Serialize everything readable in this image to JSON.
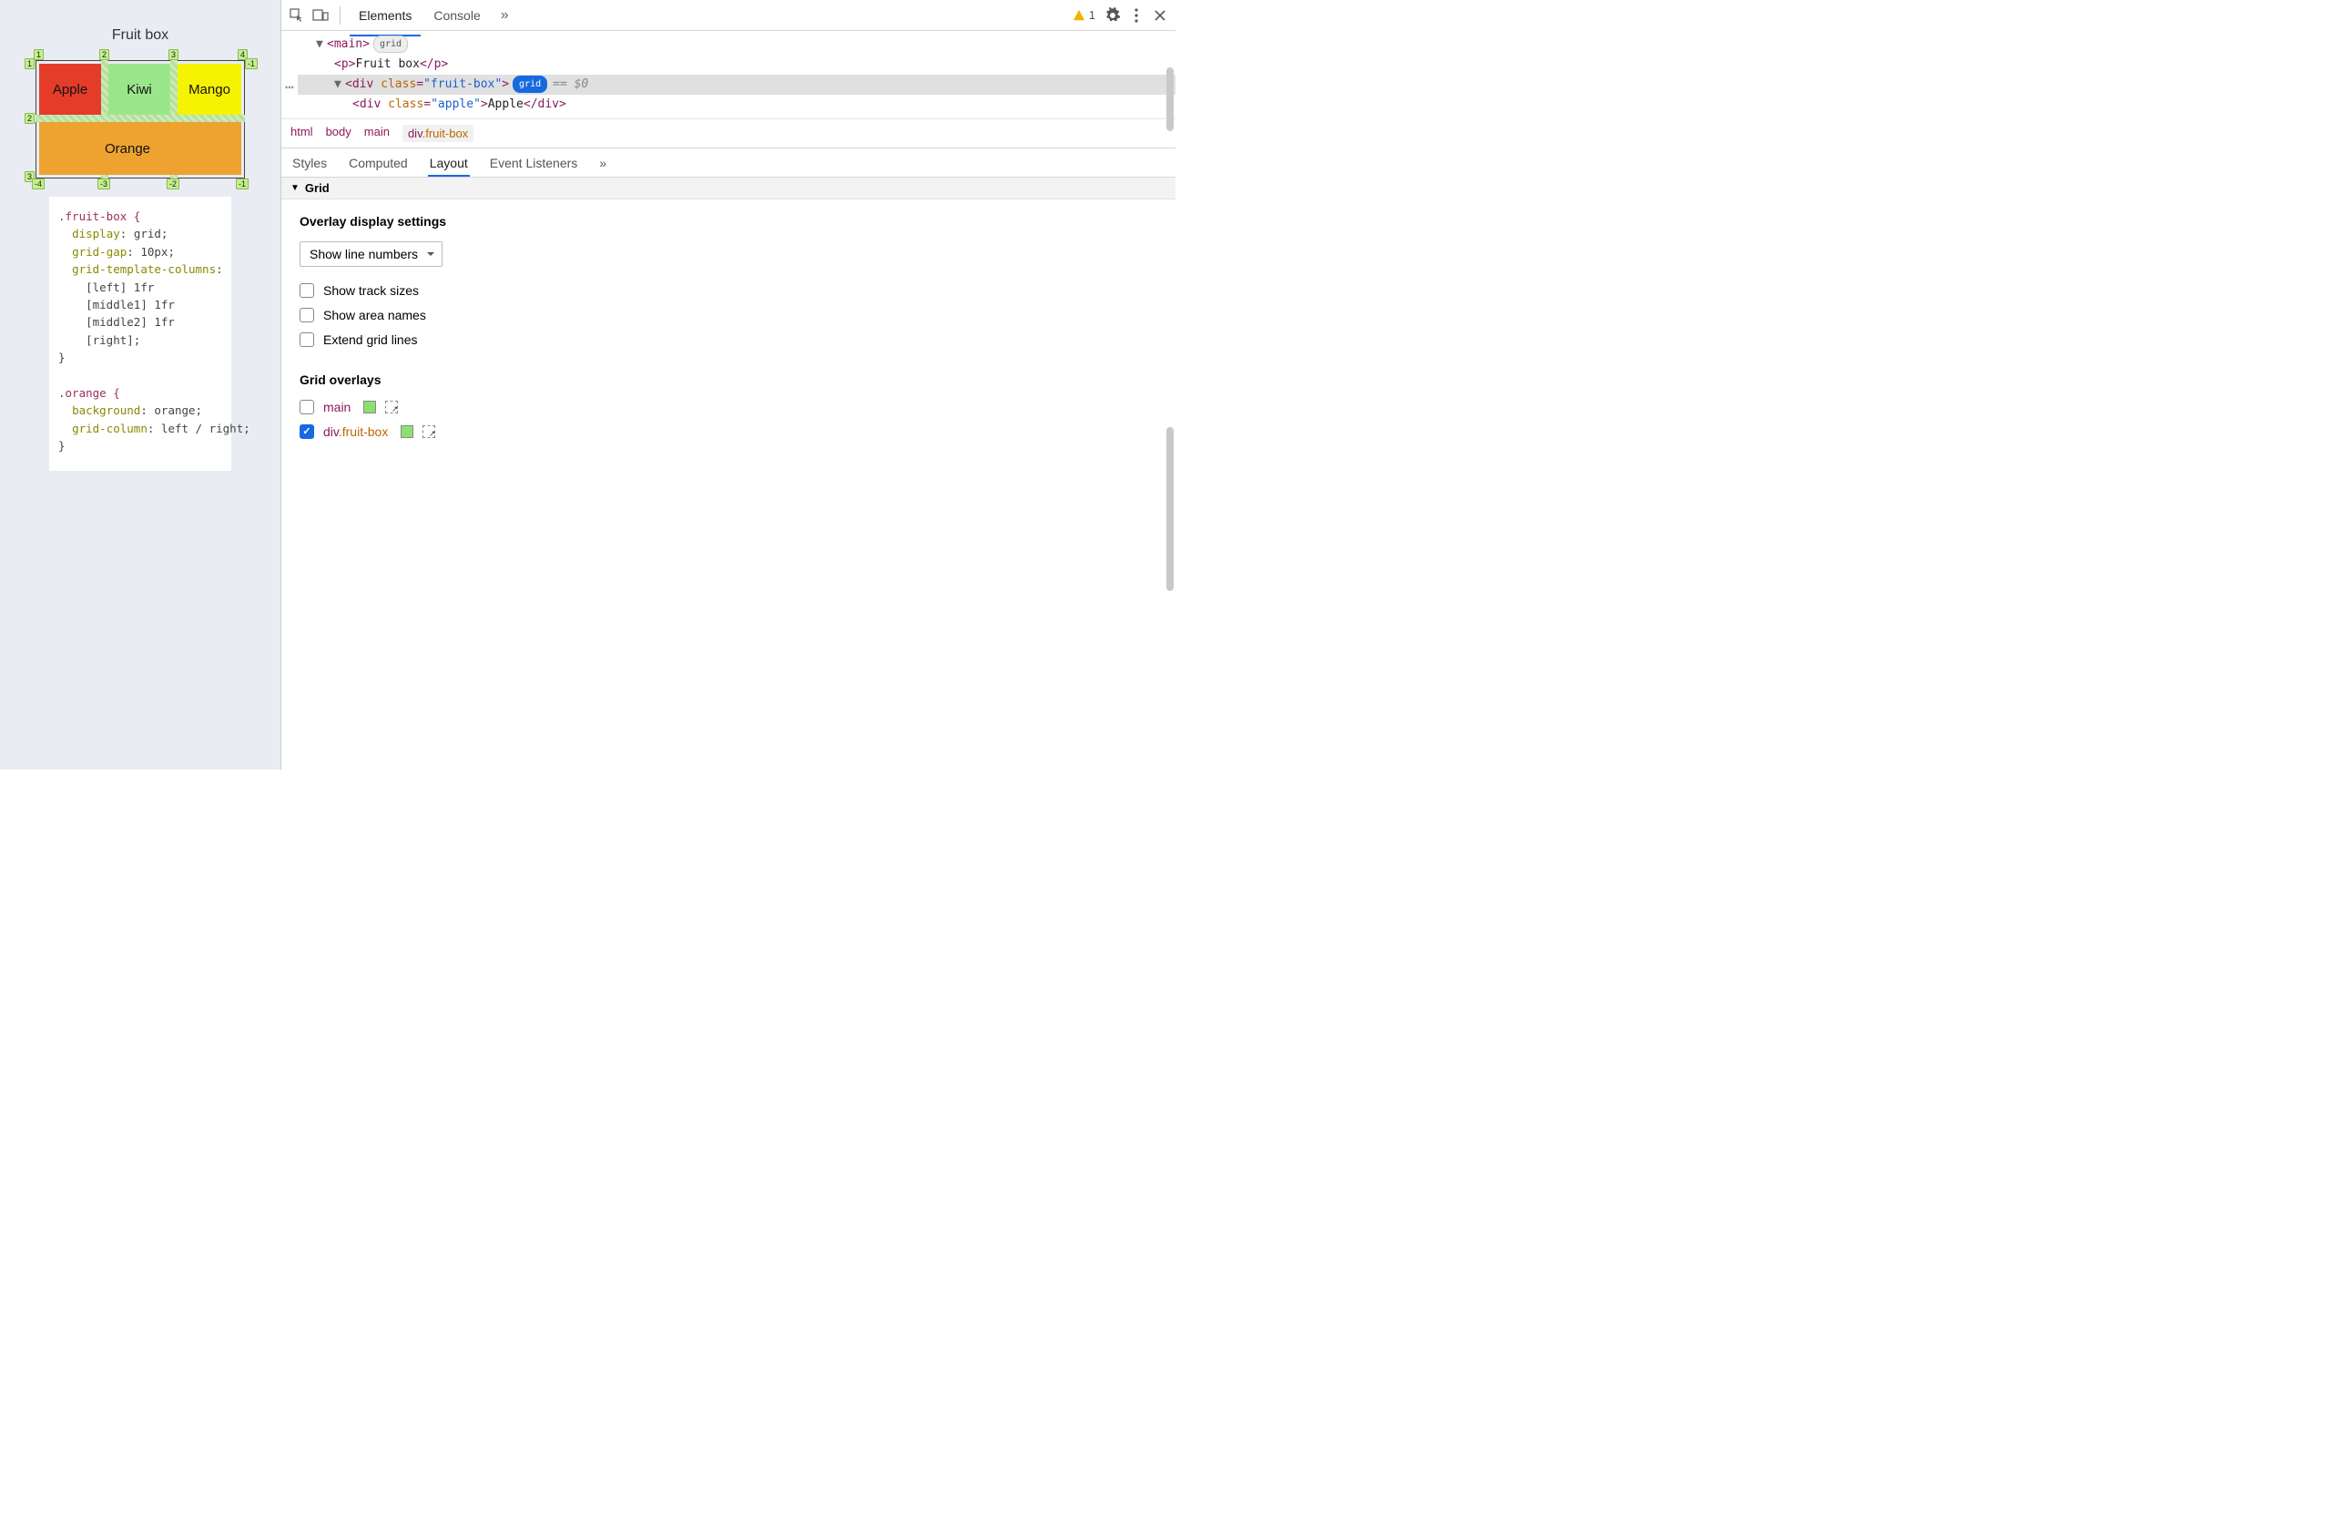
{
  "demo": {
    "title": "Fruit box",
    "cells": {
      "apple": "Apple",
      "kiwi": "Kiwi",
      "mango": "Mango",
      "orange": "Orange"
    },
    "top_nums": [
      "1",
      "2",
      "3",
      "4"
    ],
    "left_nums": [
      "1",
      "2",
      "3"
    ],
    "bottom_nums": [
      "-4",
      "-3",
      "-2",
      "-1"
    ],
    "right_top": "-1",
    "right_bottom": "-1"
  },
  "code": {
    "l1": ".fruit-box {",
    "l2_p": "display",
    "l2_v": "grid",
    "l3_p": "grid-gap",
    "l3_v": "10px",
    "l4_p": "grid-template-columns",
    "l5": "[left] 1fr",
    "l6": "[middle1] 1fr",
    "l7": "[middle2] 1fr",
    "l8": "[right]",
    "l9": "}",
    "l10": ".orange {",
    "l11_p": "background",
    "l11_v": "orange",
    "l12_p": "grid-column",
    "l12_v": "left / right",
    "l13": "}"
  },
  "toolbar": {
    "tabs": {
      "elements": "Elements",
      "console": "Console"
    },
    "more": "»",
    "warn_count": "1"
  },
  "dom": {
    "main_open": "<main>",
    "main_badge": "grid",
    "p_open": "<p>",
    "p_text": "Fruit box",
    "p_close": "</p>",
    "div_open_prefix": "<div ",
    "div_class_attr": "class",
    "div_class_val": "\"fruit-box\"",
    "div_open_suffix": ">",
    "div_badge": "grid",
    "div_after": "== $0",
    "child_open": "<div ",
    "child_class": "class",
    "child_val": "\"apple\"",
    "child_suffix": ">",
    "child_text": "Apple",
    "child_close": "</div>"
  },
  "crumbs": [
    "html",
    "body",
    "main",
    "div.fruit-box"
  ],
  "styles_tabs": {
    "styles": "Styles",
    "computed": "Computed",
    "layout": "Layout",
    "listeners": "Event Listeners",
    "more": "»"
  },
  "grid_section": {
    "title": "Grid"
  },
  "overlay_settings": {
    "heading": "Overlay display settings",
    "select_label": "Show line numbers",
    "cb1": "Show track sizes",
    "cb2": "Show area names",
    "cb3": "Extend grid lines"
  },
  "grid_overlays": {
    "heading": "Grid overlays",
    "items": [
      {
        "label": "main",
        "checked": false
      },
      {
        "label": "div.fruit-box",
        "checked": true
      }
    ]
  }
}
